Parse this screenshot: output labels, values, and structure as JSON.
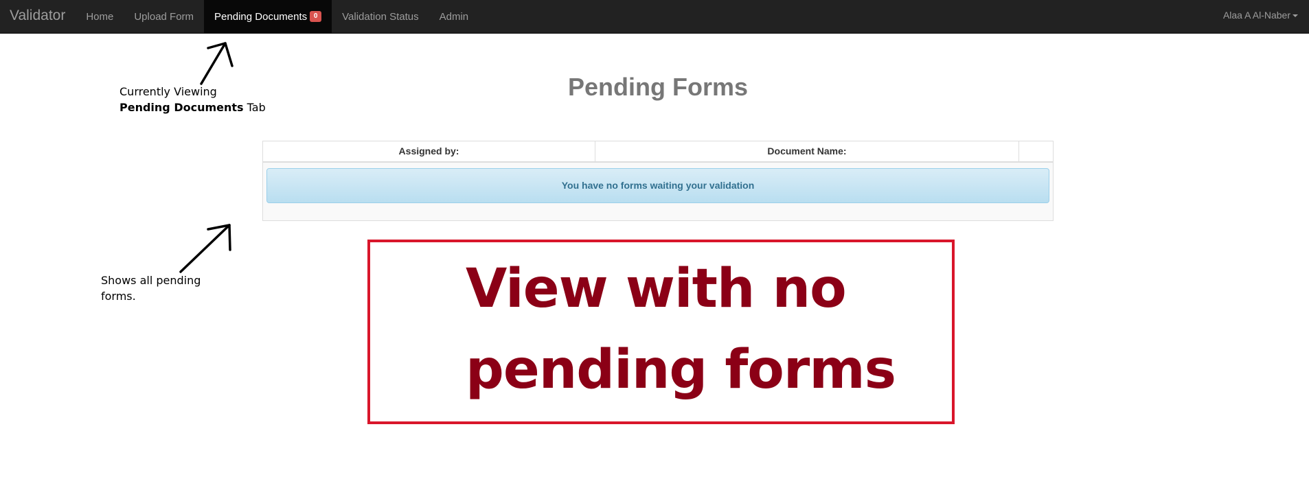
{
  "navbar": {
    "brand": "Validator",
    "items": [
      {
        "label": "Home",
        "active": false
      },
      {
        "label": "Upload Form",
        "active": false
      },
      {
        "label": "Pending Documents",
        "active": true,
        "badge": "0"
      },
      {
        "label": "Validation Status",
        "active": false
      },
      {
        "label": "Admin",
        "active": false
      }
    ],
    "user": "Alaa A Al-Naber"
  },
  "page": {
    "title": "Pending Forms"
  },
  "table": {
    "headers": [
      "Assigned by:",
      "Document Name:",
      ""
    ],
    "empty_message": "You have no forms waiting your validation"
  },
  "annotations": {
    "tab_note_line1": "Currently Viewing",
    "tab_note_bold": "Pending Documents",
    "tab_note_rest": " Tab",
    "list_note": "Shows all pending forms.",
    "callout_line1": "View with no",
    "callout_line2": "pending forms"
  },
  "colors": {
    "navbar_bg": "#222222",
    "badge": "#d9534f",
    "callout_border": "#d9162b",
    "callout_text": "#8b0016"
  }
}
